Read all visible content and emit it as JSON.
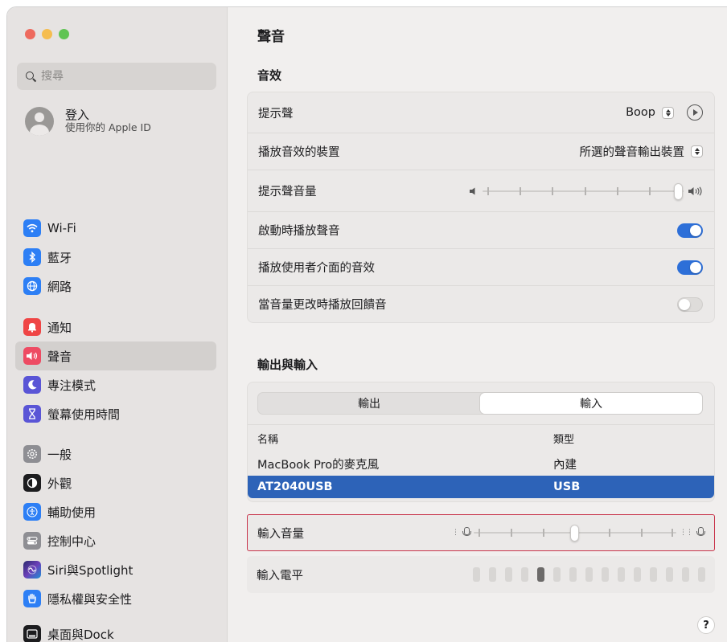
{
  "window": {
    "traffic_lights": [
      "#ee6a5e",
      "#f5bd4f",
      "#61c454"
    ]
  },
  "sidebar": {
    "search_placeholder": "搜尋",
    "account": {
      "title": "登入",
      "subtitle": "使用你的 Apple ID"
    },
    "groups": [
      [
        {
          "label": "Wi-Fi",
          "icon": "wifi-icon",
          "color": "#2d7ff5",
          "glyph": "≋"
        },
        {
          "label": "藍牙",
          "icon": "bluetooth-icon",
          "color": "#2d7ff5",
          "glyph": "ᛒ"
        },
        {
          "label": "網路",
          "icon": "globe-icon",
          "color": "#2d7ff5",
          "glyph": "⊕"
        }
      ],
      [
        {
          "label": "通知",
          "icon": "bell-icon",
          "color": "#ef4545",
          "glyph": "▲"
        },
        {
          "label": "聲音",
          "icon": "speaker-icon",
          "color": "#ee4b63",
          "glyph": "◀",
          "selected": true
        },
        {
          "label": "專注模式",
          "icon": "moon-icon",
          "color": "#5a55d6",
          "glyph": "☾"
        },
        {
          "label": "螢幕使用時間",
          "icon": "hourglass-icon",
          "color": "#5a55d6",
          "glyph": "⧗"
        }
      ],
      [
        {
          "label": "一般",
          "icon": "gear-icon",
          "color": "#8e8e93",
          "glyph": "⚙"
        },
        {
          "label": "外觀",
          "icon": "appearance-icon",
          "color": "#1d1d1f",
          "glyph": "◐"
        },
        {
          "label": "輔助使用",
          "icon": "accessibility-icon",
          "color": "#2d7ff5",
          "glyph": "✱"
        },
        {
          "label": "控制中心",
          "icon": "control-center-icon",
          "color": "#8e8e93",
          "glyph": "☰"
        },
        {
          "label": "Siri與Spotlight",
          "icon": "siri-icon",
          "color": "#3a3a8c",
          "glyph": "◉"
        },
        {
          "label": "隱私權與安全性",
          "icon": "hand-icon",
          "color": "#2d7ff5",
          "glyph": "✋"
        },
        {
          "label": "桌面與Dock",
          "icon": "dock-icon",
          "color": "#1d1d1f",
          "glyph": "▭"
        }
      ]
    ]
  },
  "main": {
    "title": "聲音",
    "effects": {
      "heading": "音效",
      "alert_sound_label": "提示聲",
      "alert_sound_value": "Boop",
      "play_device_label": "播放音效的裝置",
      "play_device_value": "所選的聲音輸出裝置",
      "alert_volume_label": "提示聲音量",
      "alert_volume_level": 1.0,
      "startup_sound_label": "啟動時播放聲音",
      "startup_sound_on": true,
      "ui_sound_label": "播放使用者介面的音效",
      "ui_sound_on": true,
      "feedback_label": "當音量更改時播放回饋音",
      "feedback_on": false
    },
    "io": {
      "heading": "輸出與輸入",
      "tabs": [
        "輸出",
        "輸入"
      ],
      "active_tab": 1,
      "columns": {
        "name": "名稱",
        "type": "類型"
      },
      "devices": [
        {
          "name": "MacBook Pro的麥克風",
          "type": "內建",
          "selected": false
        },
        {
          "name": "AT2040USB",
          "type": "USB",
          "selected": true
        }
      ],
      "input_volume_label": "輸入音量",
      "input_volume_level": 0.5,
      "input_level_label": "輸入電平",
      "input_level_bars": 15,
      "input_level_lit": 5
    },
    "help_label": "?"
  },
  "accent": "#2d6fd8",
  "selection_color": "#2d63b8"
}
